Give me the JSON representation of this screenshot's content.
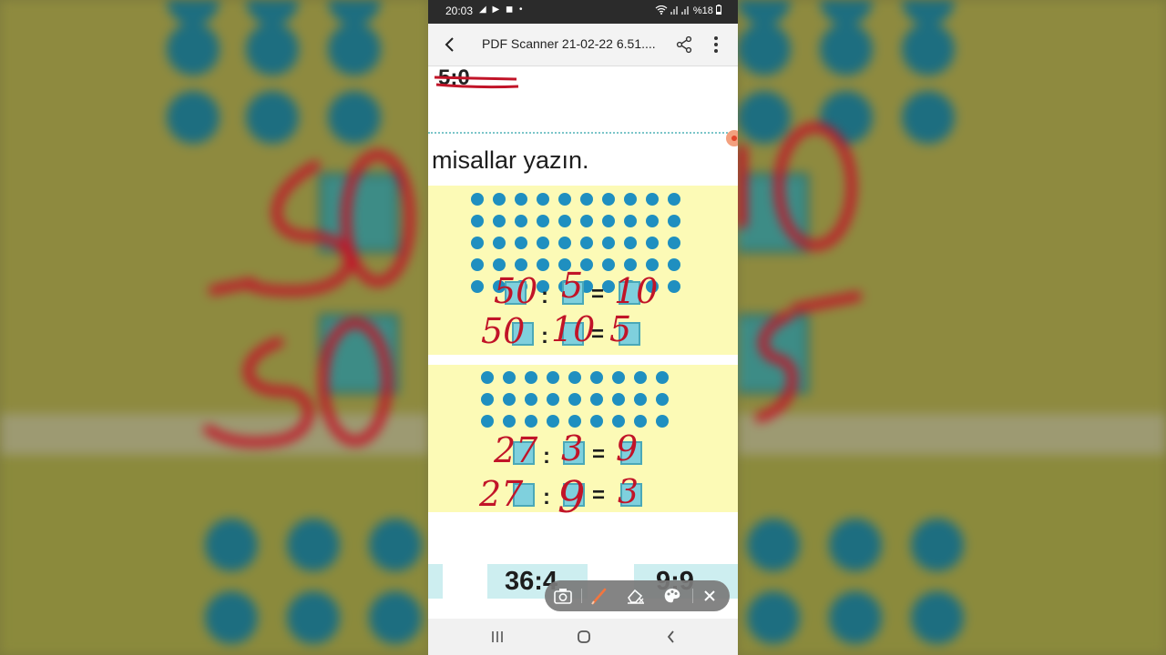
{
  "status_bar": {
    "time": "20:03",
    "icons": "◢ ▶ ◼ •",
    "battery": "%18"
  },
  "app_bar": {
    "title": "PDF Scanner 21-02-22 6.51....",
    "back_icon": "back-arrow-icon",
    "share_icon": "share-icon",
    "more_icon": "more-vertical-icon"
  },
  "document": {
    "top_strike_text": "5:0",
    "instruction": "misallar yazın.",
    "exercise_1": {
      "dot_rows": 5,
      "dot_cols": 10,
      "line_1": {
        "dividend": "50",
        "divisor": "5",
        "quotient": "10"
      },
      "line_2": {
        "dividend": "50",
        "divisor": "10",
        "quotient": "5"
      }
    },
    "exercise_2": {
      "dot_rows": 3,
      "dot_cols": 9,
      "line_1": {
        "dividend": "27",
        "divisor": "3",
        "quotient": "9"
      },
      "line_2": {
        "dividend": "27",
        "divisor": "9",
        "quotient": "3"
      }
    },
    "bottom_expressions": [
      "36:4",
      "9:9"
    ],
    "symbols": {
      "colon": ":",
      "equals": "="
    }
  },
  "pen_toolbar": {
    "tools": [
      "camera-icon",
      "pen-icon",
      "eraser-icon",
      "palette-icon",
      "close-icon"
    ]
  },
  "nav_bar": {
    "buttons": [
      "recents-icon",
      "home-icon",
      "back-icon"
    ]
  },
  "colors": {
    "ink": "#c11428",
    "dot": "#1f8fc0",
    "panel": "#fcfab6",
    "status_bar": "#2b2b2b"
  }
}
